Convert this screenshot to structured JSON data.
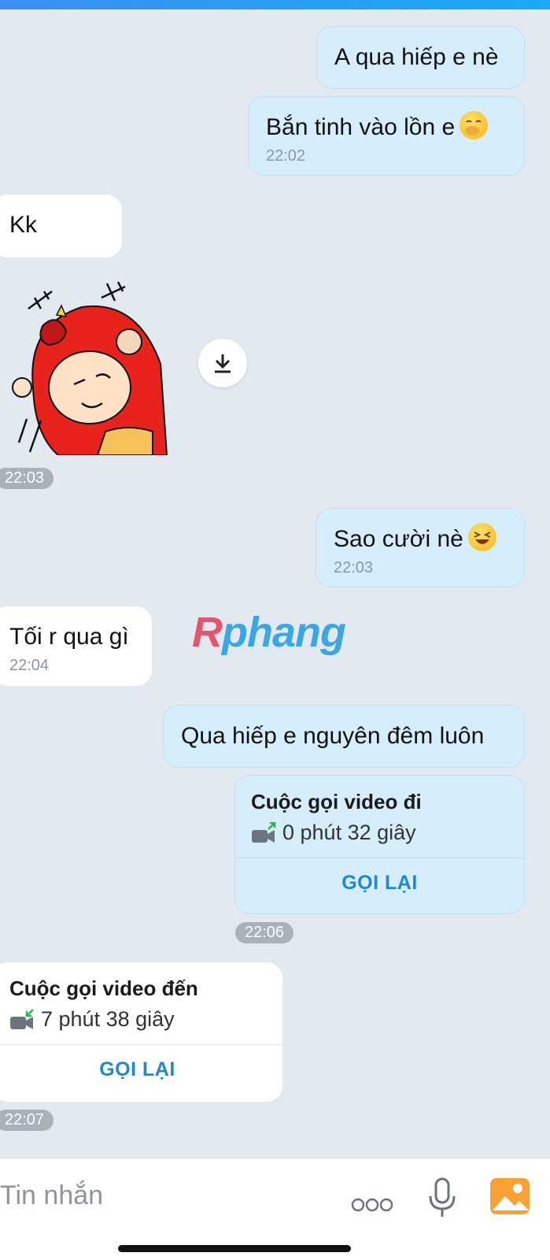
{
  "messages": {
    "m1": {
      "text": "A qua hiếp e nè"
    },
    "m2": {
      "text": "Bắn tinh vào lồn e",
      "emoji": "hand-over-mouth-emoji",
      "time": "22:02"
    },
    "m3": {
      "text": "Kk"
    },
    "sticker": {
      "name": "red-hooded-character-sticker"
    },
    "sticker_time": "22:03",
    "m4": {
      "text": "Sao cười nè",
      "emoji": "laughing-emoji",
      "time": "22:03"
    },
    "m5": {
      "text": "Tối r qua gì",
      "time": "22:04"
    },
    "m6": {
      "text": "Qua hiếp e nguyên đêm luôn"
    }
  },
  "call_out": {
    "title": "Cuộc gọi video đi",
    "duration": "0 phút 32 giây",
    "action": "GỌI LẠI",
    "time": "22:06"
  },
  "call_in": {
    "title": "Cuộc gọi video đến",
    "duration": "7 phút 38 giây",
    "action": "GỌI LẠI",
    "time": "22:07"
  },
  "watermark": {
    "part1": "R",
    "part2": "phang"
  },
  "composer": {
    "placeholder": "Tin nhắn",
    "icons": [
      "more-dots-icon",
      "microphone-icon",
      "image-gallery-icon"
    ]
  },
  "colors": {
    "background": "#e2e9f1",
    "outgoing_bubble": "#d6eefb",
    "incoming_bubble": "#ffffff",
    "accent": "#1e88d2",
    "time_pill": "#a9b1ba"
  }
}
